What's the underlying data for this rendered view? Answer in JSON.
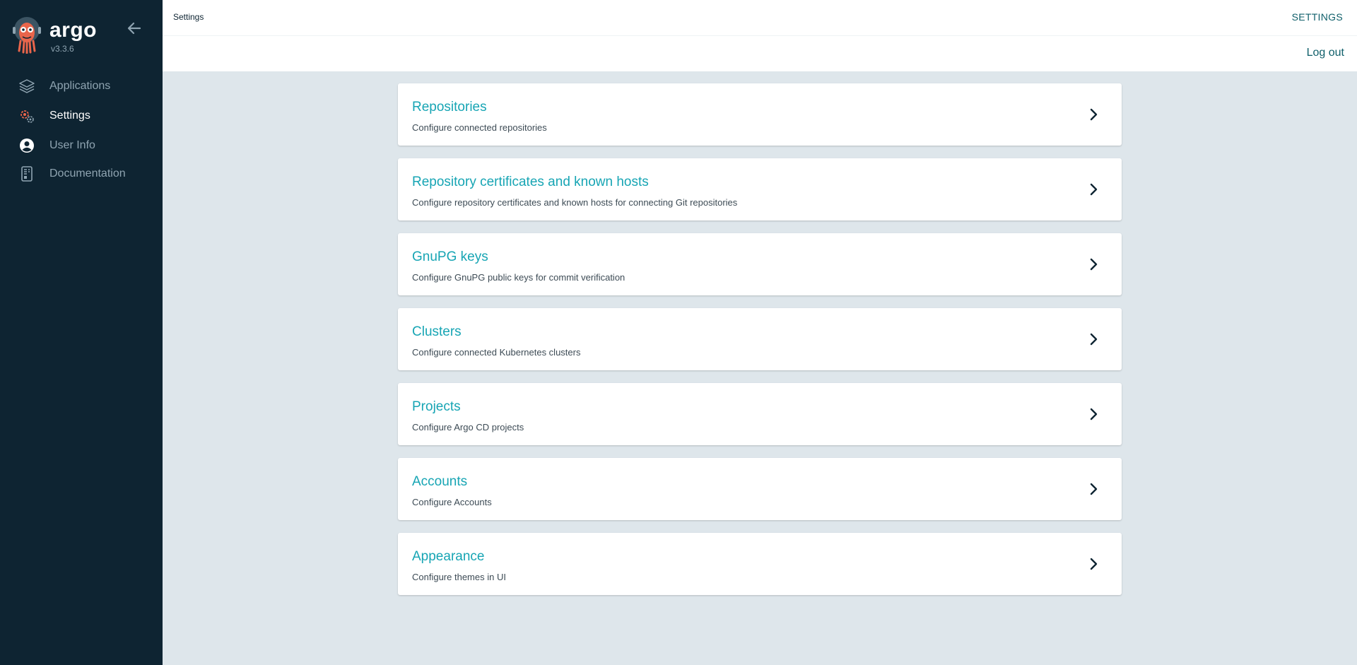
{
  "sidebar": {
    "brand_name": "argo",
    "version": "v3.3.6",
    "items": [
      {
        "label": "Applications",
        "icon": "layers-icon",
        "active": false
      },
      {
        "label": "Settings",
        "icon": "gears-icon",
        "active": true
      },
      {
        "label": "User Info",
        "icon": "user-circle-icon",
        "active": false
      },
      {
        "label": "Documentation",
        "icon": "book-icon",
        "active": false
      }
    ]
  },
  "header": {
    "breadcrumb": "Settings",
    "title": "SETTINGS",
    "logout_label": "Log out"
  },
  "cards": [
    {
      "title": "Repositories",
      "description": "Configure connected repositories"
    },
    {
      "title": "Repository certificates and known hosts",
      "description": "Configure repository certificates and known hosts for connecting Git repositories"
    },
    {
      "title": "GnuPG keys",
      "description": "Configure GnuPG public keys for commit verification"
    },
    {
      "title": "Clusters",
      "description": "Configure connected Kubernetes clusters"
    },
    {
      "title": "Projects",
      "description": "Configure Argo CD projects"
    },
    {
      "title": "Accounts",
      "description": "Configure Accounts"
    },
    {
      "title": "Appearance",
      "description": "Configure themes in UI"
    }
  ],
  "colors": {
    "sidebar_bg": "#0e2432",
    "accent": "#17a5b4",
    "page_bg": "#dee6eb",
    "logo_orange": "#e9654b"
  }
}
